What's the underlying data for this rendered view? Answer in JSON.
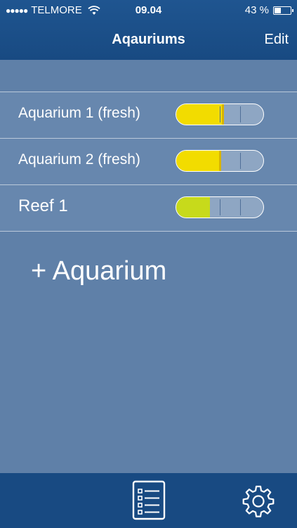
{
  "status_bar": {
    "signal": "●●●●●",
    "carrier": "TELMORE",
    "time": "09.04",
    "battery_percent": "43 %",
    "battery_level": 0.43
  },
  "nav": {
    "title": "Aqauriums",
    "edit_label": "Edit"
  },
  "aquariums": [
    {
      "name": "Aquarium 1 (fresh)",
      "level": 0.55,
      "color": "#f2dc00"
    },
    {
      "name": "Aquarium 2 (fresh)",
      "level": 0.52,
      "color": "#f2dc00"
    },
    {
      "name": "Reef 1",
      "level": 0.39,
      "color": "#c7da1b"
    }
  ],
  "add_label": "+ Aquarium",
  "tab_bar": {
    "items": [
      "list-icon",
      "gear-icon"
    ]
  }
}
